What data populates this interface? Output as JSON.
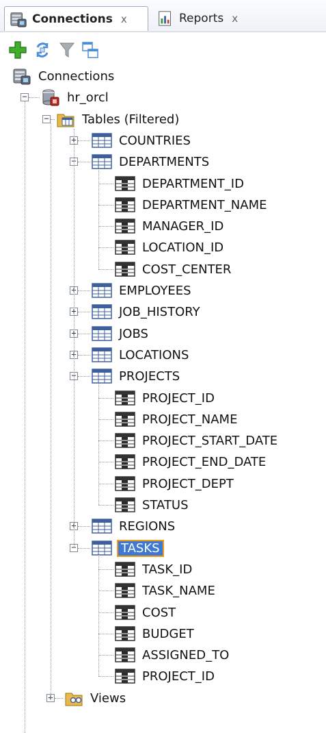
{
  "tabs": [
    {
      "label": "Connections",
      "close": "x",
      "active": true,
      "icon": "connections-db-icon"
    },
    {
      "label": "Reports",
      "close": "x",
      "active": false,
      "icon": "reports-icon"
    }
  ],
  "toolbar": {
    "buttons": [
      "add-connection-icon",
      "refresh-icon",
      "filter-icon",
      "schema-browser-icon"
    ]
  },
  "tree": {
    "root": "Connections",
    "connection": "hr_orcl",
    "tables_folder": "Tables (Filtered)",
    "tables": [
      {
        "name": "COUNTRIES",
        "expanded": false
      },
      {
        "name": "DEPARTMENTS",
        "expanded": true,
        "columns": [
          "DEPARTMENT_ID",
          "DEPARTMENT_NAME",
          "MANAGER_ID",
          "LOCATION_ID",
          "COST_CENTER"
        ]
      },
      {
        "name": "EMPLOYEES",
        "expanded": false
      },
      {
        "name": "JOB_HISTORY",
        "expanded": false
      },
      {
        "name": "JOBS",
        "expanded": false
      },
      {
        "name": "LOCATIONS",
        "expanded": false
      },
      {
        "name": "PROJECTS",
        "expanded": true,
        "columns": [
          "PROJECT_ID",
          "PROJECT_NAME",
          "PROJECT_START_DATE",
          "PROJECT_END_DATE",
          "PROJECT_DEPT",
          "STATUS"
        ]
      },
      {
        "name": "REGIONS",
        "expanded": false
      },
      {
        "name": "TASKS",
        "expanded": true,
        "selected": true,
        "columns": [
          "TASK_ID",
          "TASK_NAME",
          "COST",
          "BUDGET",
          "ASSIGNED_TO",
          "PROJECT_ID"
        ]
      }
    ],
    "views_folder": "Views"
  },
  "colors": {
    "selection": "#3f78d0",
    "focus_border": "#f09c1a",
    "table_icon": "#3d5f9e",
    "folder": "#e9b949"
  }
}
